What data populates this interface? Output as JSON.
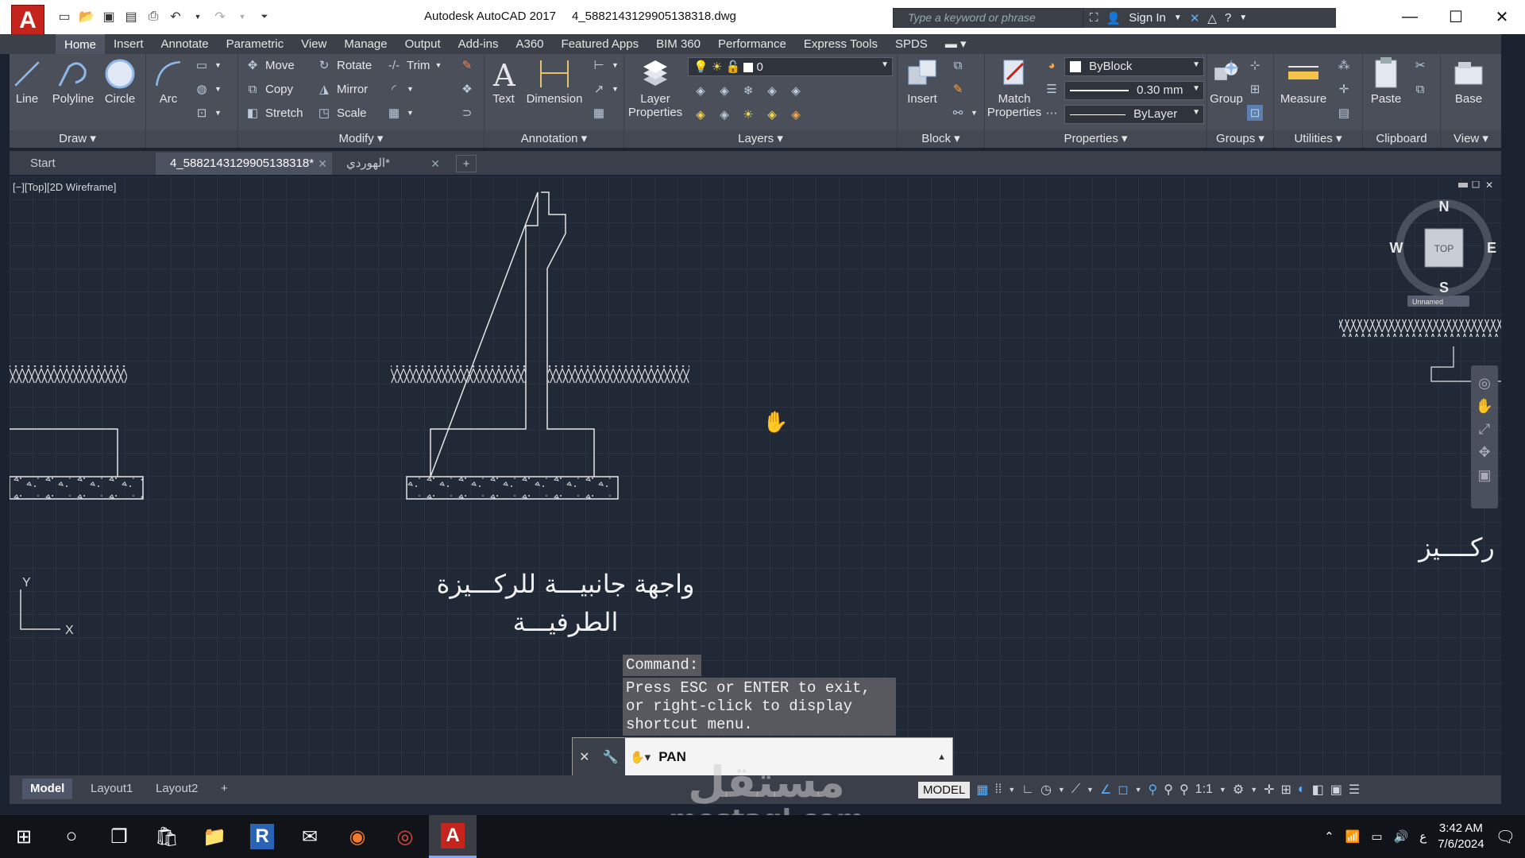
{
  "titlebar": {
    "app_letter": "A",
    "app_name": "Autodesk AutoCAD 2017",
    "file_name": "4_588214312990513831 8.dwg",
    "search_placeholder": "Type a keyword or phrase",
    "sign_in": "Sign In"
  },
  "ribbon_tabs": [
    "Home",
    "Insert",
    "Annotate",
    "Parametric",
    "View",
    "Manage",
    "Output",
    "Add-ins",
    "A360",
    "Featured Apps",
    "BIM 360",
    "Performance",
    "Express Tools",
    "SPDS"
  ],
  "ribbon": {
    "draw": {
      "title": "Draw",
      "line": "Line",
      "polyline": "Polyline",
      "circle": "Circle",
      "arc": "Arc"
    },
    "modify": {
      "title": "Modify",
      "move": "Move",
      "rotate": "Rotate",
      "trim": "Trim",
      "copy": "Copy",
      "mirror": "Mirror",
      "stretch": "Stretch",
      "scale": "Scale"
    },
    "annotation": {
      "title": "Annotation",
      "text": "Text",
      "dimension": "Dimension"
    },
    "layers": {
      "title": "Layers",
      "layer_properties_1": "Layer",
      "layer_properties_2": "Properties",
      "current_layer": "0"
    },
    "block": {
      "title": "Block",
      "insert": "Insert"
    },
    "properties": {
      "title": "Properties",
      "match_1": "Match",
      "match_2": "Properties",
      "color": "ByBlock",
      "lineweight": "0.30 mm",
      "linetype": "ByLayer"
    },
    "groups": {
      "title": "Groups",
      "group": "Group"
    },
    "utilities": {
      "title": "Utilities",
      "measure": "Measure"
    },
    "clipboard": {
      "title": "Clipboard",
      "paste": "Paste"
    },
    "view": {
      "title": "View",
      "base": "Base"
    }
  },
  "doc_tabs": {
    "start": "Start",
    "active": "4_5882143129905138318*",
    "other": "الهوردي*"
  },
  "canvas": {
    "viewport_label": "[−][Top][2D Wireframe]",
    "title_line1": "واجهة جانبيـــة للركـــيزة",
    "title_line2": "الطرفيـــة",
    "title_partial": "ركــــيز",
    "compass": {
      "n": "N",
      "s": "S",
      "e": "E",
      "w": "W",
      "top": "TOP"
    },
    "ucs_y": "Y",
    "ucs_x": "X",
    "unnamed": "Unnamed"
  },
  "command": {
    "label": "Command:",
    "history": "Press ESC or ENTER to exit, or right-click to display shortcut menu.",
    "current": "PAN"
  },
  "layout_tabs": [
    "Model",
    "Layout1",
    "Layout2"
  ],
  "status": {
    "model": "MODEL",
    "scale": "1:1"
  },
  "watermark": {
    "arabic": "مستقل",
    "latin": "mostaql.com"
  },
  "taskbar": {
    "time": "3:42 AM",
    "date": "7/6/2024",
    "lang": "ع"
  },
  "colors": {
    "accent": "#c4241c",
    "canvas": "#212836",
    "ribbon": "#4a4f5a"
  }
}
